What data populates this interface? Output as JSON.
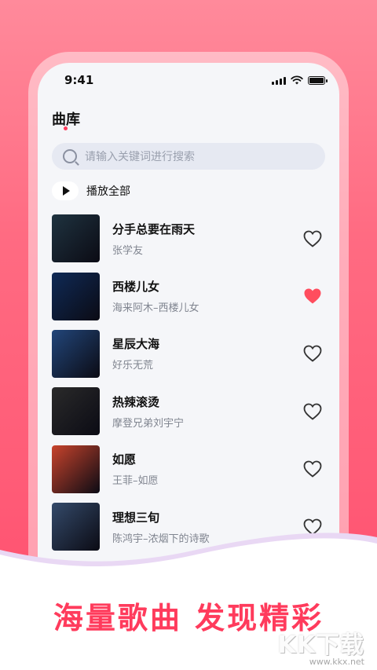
{
  "status_bar": {
    "time": "9:41"
  },
  "page": {
    "title": "曲库"
  },
  "search": {
    "placeholder": "请输入关键词进行搜索"
  },
  "play_all": {
    "label": "播放全部"
  },
  "songs": [
    {
      "title": "分手总要在雨天",
      "artist": "张学友",
      "liked": false,
      "cover_color": "#1f3340",
      "cover_text": ""
    },
    {
      "title": "西楼儿女",
      "artist": "海来阿木–西楼儿女",
      "liked": true,
      "cover_color": "#0f2a56",
      "cover_text": ""
    },
    {
      "title": "星辰大海",
      "artist": "好乐无荒",
      "liked": false,
      "cover_color": "#22467a",
      "cover_text": ""
    },
    {
      "title": "热辣滚烫",
      "artist": "摩登兄弟刘宇宁",
      "liked": false,
      "cover_color": "#2a2a2a",
      "cover_text": ""
    },
    {
      "title": "如愿",
      "artist": "王菲–如愿",
      "liked": false,
      "cover_color": "#c8432c",
      "cover_text": ""
    },
    {
      "title": "理想三旬",
      "artist": "陈鸿宇–浓烟下的诗歌",
      "liked": false,
      "cover_color": "#344a6a",
      "cover_text": ""
    }
  ],
  "slogan": "海量歌曲  发现精彩",
  "watermark": {
    "logo": "KK下载",
    "url": "www.kkx.net"
  },
  "colors": {
    "accent": "#ff3b5c",
    "heart_liked": "#ff4d5e",
    "heart_outline": "#333333"
  }
}
